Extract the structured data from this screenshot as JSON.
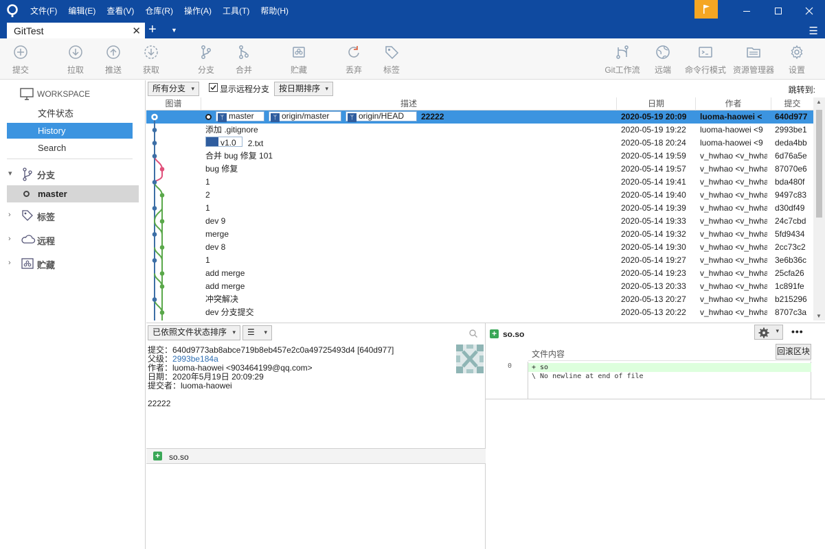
{
  "menu": [
    "文件(F)",
    "编辑(E)",
    "查看(V)",
    "仓库(R)",
    "操作(A)",
    "工具(T)",
    "帮助(H)"
  ],
  "tab": {
    "title": "GitTest"
  },
  "toolbar": {
    "commit": "提交",
    "pull": "拉取",
    "push": "推送",
    "fetch": "获取",
    "branch": "分支",
    "merge": "合并",
    "stash": "贮藏",
    "discard": "丢弃",
    "tag": "标签",
    "gitflow": "Git工作流",
    "remote": "远端",
    "terminal": "命令行模式",
    "explorer": "资源管理器",
    "settings": "设置"
  },
  "sidebar": {
    "workspace": "WORKSPACE",
    "file_status": "文件状态",
    "history": "History",
    "search": "Search",
    "branches": "分支",
    "current_branch": "master",
    "tags": "标签",
    "remotes": "远程",
    "stashes": "贮藏"
  },
  "filter": {
    "branch_filter": "所有分支",
    "show_remote": "显示远程分支",
    "sort": "按日期排序",
    "jump": "跳转到:"
  },
  "columns": {
    "graph": "图谱",
    "desc": "描述",
    "date": "日期",
    "author": "作者",
    "commit": "提交"
  },
  "commits": [
    {
      "desc": "22222",
      "refs": [
        "master",
        "origin/master",
        "origin/HEAD"
      ],
      "date": "2020-05-19 20:09",
      "author": "luoma-haowei <",
      "hash": "640d977"
    },
    {
      "desc": "添加 .gitignore",
      "date": "2020-05-19 19:22",
      "author": "luoma-haowei <9",
      "hash": "2993be1"
    },
    {
      "desc": "2.txt",
      "tag": "v1.0",
      "date": "2020-05-18 20:24",
      "author": "luoma-haowei <9",
      "hash": "deda4bb"
    },
    {
      "desc": "合并 bug 修复 101",
      "date": "2020-05-14 19:59",
      "author": "v_hwhao <v_hwha",
      "hash": "6d76a5e"
    },
    {
      "desc": "bug 修复",
      "date": "2020-05-14 19:57",
      "author": "v_hwhao <v_hwha",
      "hash": "87070e6"
    },
    {
      "desc": "1",
      "date": "2020-05-14 19:41",
      "author": "v_hwhao <v_hwha",
      "hash": "bda480f"
    },
    {
      "desc": "2",
      "date": "2020-05-14 19:40",
      "author": "v_hwhao <v_hwha",
      "hash": "9497c83"
    },
    {
      "desc": "1",
      "date": "2020-05-14 19:39",
      "author": "v_hwhao <v_hwha",
      "hash": "d30df49"
    },
    {
      "desc": "dev 9",
      "date": "2020-05-14 19:33",
      "author": "v_hwhao <v_hwha",
      "hash": "24c7cbd"
    },
    {
      "desc": "merge",
      "date": "2020-05-14 19:32",
      "author": "v_hwhao <v_hwha",
      "hash": "5fd9434"
    },
    {
      "desc": "dev 8",
      "date": "2020-05-14 19:30",
      "author": "v_hwhao <v_hwha",
      "hash": "2cc73c2"
    },
    {
      "desc": "1",
      "date": "2020-05-14 19:27",
      "author": "v_hwhao <v_hwha",
      "hash": "3e6b36c"
    },
    {
      "desc": "add merge",
      "date": "2020-05-14 19:23",
      "author": "v_hwhao <v_hwha",
      "hash": "25cfa26"
    },
    {
      "desc": "add merge",
      "date": "2020-05-13 20:33",
      "author": "v_hwhao <v_hwha",
      "hash": "1c891fe"
    },
    {
      "desc": "冲突解决",
      "date": "2020-05-13 20:27",
      "author": "v_hwhao <v_hwha",
      "hash": "b215296"
    },
    {
      "desc": "dev 分支提交",
      "date": "2020-05-13 20:22",
      "author": "v_hwhao <v_hwha",
      "hash": "8707c3a"
    }
  ],
  "details": {
    "sort": "已依照文件状态排序",
    "commit_label": "提交：",
    "commit_value": "640d9773ab8abce719b8eb457e2c0a49725493d4 [640d977]",
    "parent_label": "父级：",
    "parent_value": "2993be184a",
    "author_label": "作者：",
    "author_value": "luoma-haowei <903464199@qq.com>",
    "date_label": "日期：",
    "date_value": "2020年5月19日 20:09:29",
    "committer_label": "提交者：",
    "committer_value": "luoma-haowei",
    "message": "22222",
    "file": "so.so"
  },
  "diff": {
    "file": "so.so",
    "header": "文件内容",
    "rollback": "回滚区块",
    "line_number": "0",
    "line1": "+ so",
    "line2": "\\ No newline at end of file"
  }
}
